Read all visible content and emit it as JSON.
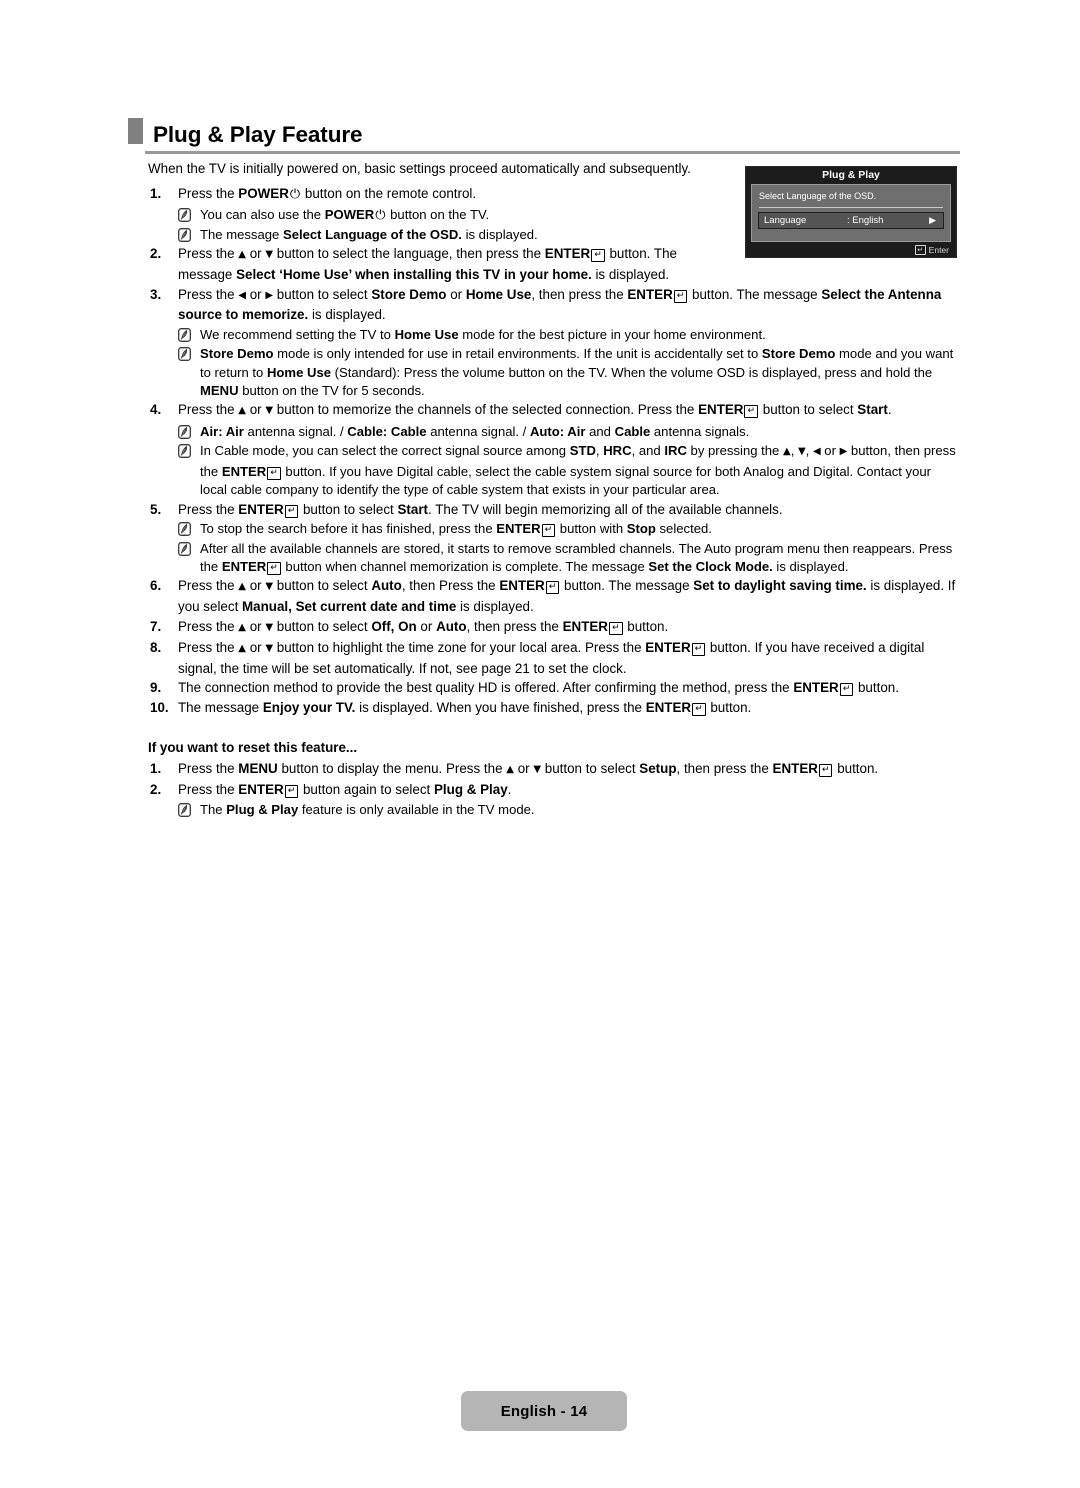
{
  "page": {
    "title": "Plug & Play Feature",
    "footer_label": "English - 14"
  },
  "intro": "When the TV is initially powered on, basic settings proceed automatically and subsequently.",
  "osd": {
    "title": "Plug & Play",
    "prompt": "Select Language of the OSD.",
    "row_label": "Language",
    "row_value": ": English",
    "row_arrow": "▶",
    "footer_label": "Enter",
    "footer_glyph": "↵",
    "colors": {
      "frame": "#1c1c1c",
      "body": "#6e6e6e",
      "highlight": "#545454",
      "text": "#ffffff"
    }
  },
  "glyphs": {
    "enter": "↵",
    "power": "⏻",
    "up": "▲",
    "down": "▼",
    "left": "◀",
    "right": "▶"
  },
  "steps": [
    {
      "num": "1.",
      "parts": [
        {
          "t": "Press the "
        },
        {
          "t": "POWER",
          "b": true
        },
        {
          "g": "power"
        },
        {
          "t": " button on the remote control."
        }
      ],
      "notes": [
        {
          "parts": [
            {
              "t": "You can also use the "
            },
            {
              "t": "POWER",
              "b": true
            },
            {
              "g": "power"
            },
            {
              "t": " button on the TV."
            }
          ]
        },
        {
          "parts": [
            {
              "t": "The message "
            },
            {
              "t": "Select Language of the OSD.",
              "b": true
            },
            {
              "t": " is displayed."
            }
          ]
        }
      ]
    },
    {
      "num": "2.",
      "narrow": true,
      "parts": [
        {
          "t": "Press the "
        },
        {
          "g": "up"
        },
        {
          "t": " or "
        },
        {
          "g": "down"
        },
        {
          "t": " button to select the language, then press the "
        },
        {
          "t": "ENTER",
          "b": true
        },
        {
          "g": "enter"
        },
        {
          "t": " button. The message "
        },
        {
          "t": "Select ‘Home Use’ when installing this TV in your home.",
          "b": true
        },
        {
          "t": " is displayed."
        }
      ],
      "notes": []
    },
    {
      "num": "3.",
      "parts": [
        {
          "t": "Press the "
        },
        {
          "g": "left"
        },
        {
          "t": " or "
        },
        {
          "g": "right"
        },
        {
          "t": " button to select "
        },
        {
          "t": "Store Demo",
          "b": true
        },
        {
          "t": " or "
        },
        {
          "t": "Home Use",
          "b": true
        },
        {
          "t": ", then press the "
        },
        {
          "t": "ENTER",
          "b": true
        },
        {
          "g": "enter"
        },
        {
          "t": " button. The message "
        },
        {
          "t": "Select the Antenna source to memorize.",
          "b": true
        },
        {
          "t": " is displayed."
        }
      ],
      "notes": [
        {
          "parts": [
            {
              "t": "We recommend setting the TV to "
            },
            {
              "t": "Home Use",
              "b": true
            },
            {
              "t": " mode for the best picture in your home environment."
            }
          ]
        },
        {
          "parts": [
            {
              "t": "Store Demo",
              "b": true
            },
            {
              "t": " mode is only intended for use in retail environments. If the unit is accidentally set to "
            },
            {
              "t": "Store Demo",
              "b": true
            },
            {
              "t": " mode and you want to return to "
            },
            {
              "t": "Home Use",
              "b": true
            },
            {
              "t": " (Standard): Press the volume button on the TV. When the volume OSD is displayed, press and hold the "
            },
            {
              "t": "MENU",
              "b": true
            },
            {
              "t": " button on the TV for 5 seconds."
            }
          ]
        }
      ]
    },
    {
      "num": "4.",
      "parts": [
        {
          "t": "Press the "
        },
        {
          "g": "up"
        },
        {
          "t": " or "
        },
        {
          "g": "down"
        },
        {
          "t": " button to memorize the channels of the selected connection. Press the "
        },
        {
          "t": "ENTER",
          "b": true
        },
        {
          "g": "enter"
        },
        {
          "t": " button to select "
        },
        {
          "t": "Start",
          "b": true
        },
        {
          "t": "."
        }
      ],
      "notes": [
        {
          "parts": [
            {
              "t": "Air: Air",
              "b": true
            },
            {
              "t": " antenna signal. / "
            },
            {
              "t": "Cable: Cable",
              "b": true
            },
            {
              "t": " antenna signal. / "
            },
            {
              "t": "Auto: Air",
              "b": true
            },
            {
              "t": " and "
            },
            {
              "t": "Cable",
              "b": true
            },
            {
              "t": " antenna signals."
            }
          ]
        },
        {
          "parts": [
            {
              "t": "In Cable mode, you can select the correct signal source among "
            },
            {
              "t": "STD",
              "b": true
            },
            {
              "t": ", "
            },
            {
              "t": "HRC",
              "b": true
            },
            {
              "t": ", and "
            },
            {
              "t": "IRC",
              "b": true
            },
            {
              "t": " by pressing the "
            },
            {
              "g": "up"
            },
            {
              "t": ", "
            },
            {
              "g": "down"
            },
            {
              "t": ", "
            },
            {
              "g": "left"
            },
            {
              "t": " or "
            },
            {
              "g": "right"
            },
            {
              "t": " button, then press the "
            },
            {
              "t": "ENTER",
              "b": true
            },
            {
              "g": "enter"
            },
            {
              "t": " button. If you have Digital cable, select the cable system signal source for both Analog and Digital. Contact your local cable company to identify the type of cable system that exists in your particular area."
            }
          ]
        }
      ]
    },
    {
      "num": "5.",
      "parts": [
        {
          "t": "Press the "
        },
        {
          "t": "ENTER",
          "b": true
        },
        {
          "g": "enter"
        },
        {
          "t": " button to select "
        },
        {
          "t": "Start",
          "b": true
        },
        {
          "t": ". The TV will begin memorizing all of the available channels."
        }
      ],
      "notes": [
        {
          "parts": [
            {
              "t": "To stop the search before it has finished, press the "
            },
            {
              "t": "ENTER",
              "b": true
            },
            {
              "g": "enter"
            },
            {
              "t": " button with "
            },
            {
              "t": "Stop",
              "b": true
            },
            {
              "t": " selected."
            }
          ]
        },
        {
          "parts": [
            {
              "t": "After all the available channels are stored, it starts to remove scrambled channels. The Auto program menu then reappears. Press the "
            },
            {
              "t": "ENTER",
              "b": true
            },
            {
              "g": "enter"
            },
            {
              "t": " button when channel memorization is complete. The message "
            },
            {
              "t": "Set the Clock Mode.",
              "b": true
            },
            {
              "t": " is displayed."
            }
          ]
        }
      ]
    },
    {
      "num": "6.",
      "parts": [
        {
          "t": "Press the "
        },
        {
          "g": "up"
        },
        {
          "t": " or "
        },
        {
          "g": "down"
        },
        {
          "t": " button to select "
        },
        {
          "t": "Auto",
          "b": true
        },
        {
          "t": ", then Press the "
        },
        {
          "t": "ENTER",
          "b": true
        },
        {
          "g": "enter"
        },
        {
          "t": " button. The message "
        },
        {
          "t": "Set to daylight saving time.",
          "b": true
        },
        {
          "t": " is displayed. If you select "
        },
        {
          "t": "Manual, Set current date and time",
          "b": true
        },
        {
          "t": " is displayed."
        }
      ],
      "notes": []
    },
    {
      "num": "7.",
      "parts": [
        {
          "t": "Press the "
        },
        {
          "g": "up"
        },
        {
          "t": " or "
        },
        {
          "g": "down"
        },
        {
          "t": " button to select "
        },
        {
          "t": "Off, On",
          "b": true
        },
        {
          "t": " or "
        },
        {
          "t": "Auto",
          "b": true
        },
        {
          "t": ", then press the "
        },
        {
          "t": "ENTER",
          "b": true
        },
        {
          "g": "enter"
        },
        {
          "t": " button."
        }
      ],
      "notes": []
    },
    {
      "num": "8.",
      "parts": [
        {
          "t": "Press the "
        },
        {
          "g": "up"
        },
        {
          "t": " or "
        },
        {
          "g": "down"
        },
        {
          "t": " button to highlight the time zone for your local area. Press the "
        },
        {
          "t": "ENTER",
          "b": true
        },
        {
          "g": "enter"
        },
        {
          "t": " button. If you have received a digital signal, the time will be set automatically. If not, see page 21 to set the clock."
        }
      ],
      "notes": []
    },
    {
      "num": "9.",
      "parts": [
        {
          "t": "The connection method to provide the best quality HD is offered. After confirming the method, press the "
        },
        {
          "t": "ENTER",
          "b": true
        },
        {
          "g": "enter"
        },
        {
          "t": " button."
        }
      ],
      "notes": []
    },
    {
      "num": "10.",
      "parts": [
        {
          "t": "The message "
        },
        {
          "t": "Enjoy your TV.",
          "b": true
        },
        {
          "t": " is displayed. When you have finished, press the "
        },
        {
          "t": "ENTER",
          "b": true
        },
        {
          "g": "enter"
        },
        {
          "t": " button."
        }
      ],
      "notes": []
    }
  ],
  "reset_section": {
    "heading": "If you want to reset this feature...",
    "steps": [
      {
        "num": "1.",
        "parts": [
          {
            "t": "Press the "
          },
          {
            "t": "MENU",
            "b": true
          },
          {
            "t": " button to display the menu. Press the "
          },
          {
            "g": "up"
          },
          {
            "t": " or "
          },
          {
            "g": "down"
          },
          {
            "t": " button to select "
          },
          {
            "t": "Setup",
            "b": true
          },
          {
            "t": ", then press the "
          },
          {
            "t": "ENTER",
            "b": true
          },
          {
            "g": "enter"
          },
          {
            "t": " button."
          }
        ],
        "notes": []
      },
      {
        "num": "2.",
        "parts": [
          {
            "t": "Press the "
          },
          {
            "t": "ENTER",
            "b": true
          },
          {
            "g": "enter"
          },
          {
            "t": " button again to select "
          },
          {
            "t": "Plug & Play",
            "b": true
          },
          {
            "t": "."
          }
        ],
        "notes": [
          {
            "parts": [
              {
                "t": "The "
              },
              {
                "t": "Plug & Play",
                "b": true
              },
              {
                "t": " feature is only available in the TV mode."
              }
            ]
          }
        ]
      }
    ]
  }
}
